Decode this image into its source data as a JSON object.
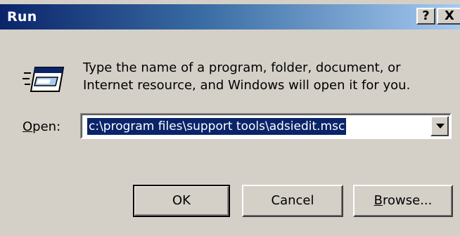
{
  "window": {
    "title": "Run",
    "help_glyph": "?",
    "close_glyph": "X"
  },
  "content": {
    "description_line1": "Type the name of a program, folder, document, or",
    "description_line2": "Internet resource, and Windows will open it for you.",
    "icon": "run-program-icon",
    "open_label_mnemonic": "O",
    "open_label_rest": "pen:",
    "open_value": "c:\\program files\\support tools\\adsiedit.msc"
  },
  "buttons": {
    "ok": "OK",
    "cancel": "Cancel",
    "browse_mnemonic": "B",
    "browse_rest": "rowse..."
  },
  "colors": {
    "title_gradient_start": "#0a246a",
    "title_gradient_end": "#a6caf0",
    "face": "#d4d0c8",
    "selection": "#0a246a"
  }
}
